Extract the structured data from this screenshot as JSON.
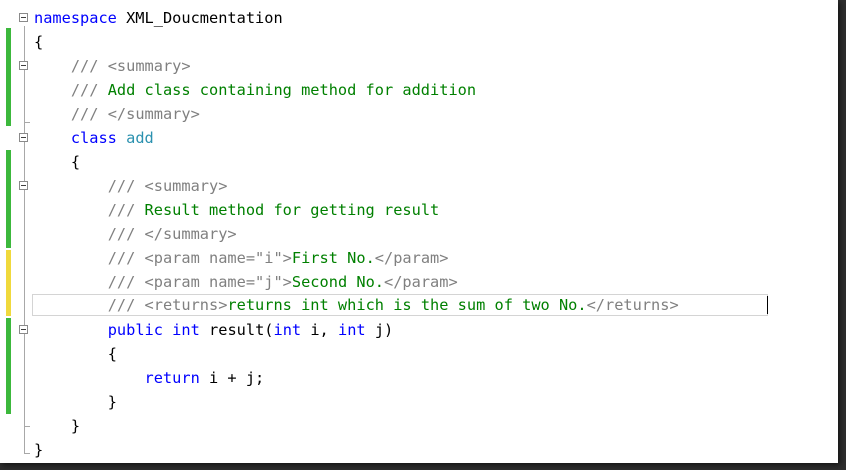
{
  "colors": {
    "keyword": "#0000ff",
    "type_name": "#2b91af",
    "comment": "#008000",
    "xml_doc_tag": "#808080",
    "saved_change_marker": "#3cb83c",
    "unsaved_change_marker": "#f0d93c"
  },
  "code": {
    "l1": {
      "kw": "namespace",
      "rest": " XML_Doucmentation"
    },
    "l2": {
      "text": "{"
    },
    "l3": {
      "indent": "    ",
      "slashes": "/// ",
      "tag": "<summary>"
    },
    "l4": {
      "indent": "    ",
      "slashes": "/// ",
      "text": "Add class containing method for addition"
    },
    "l5": {
      "indent": "    ",
      "slashes": "/// ",
      "tag": "</summary>"
    },
    "l6": {
      "indent": "    ",
      "kw": "class",
      "space": " ",
      "type": "add"
    },
    "l7": {
      "indent": "    ",
      "text": "{"
    },
    "l8": {
      "indent": "        ",
      "slashes": "/// ",
      "tag": "<summary>"
    },
    "l9": {
      "indent": "        ",
      "slashes": "/// ",
      "text": "Result method for getting result"
    },
    "l10": {
      "indent": "        ",
      "slashes": "/// ",
      "tag": "</summary>"
    },
    "l11": {
      "indent": "        ",
      "slashes": "/// ",
      "tag_open": "<param name=\"i\">",
      "text": "First No.",
      "tag_close": "</param>"
    },
    "l12": {
      "indent": "        ",
      "slashes": "/// ",
      "tag_open": "<param name=\"j\">",
      "text": "Second No.",
      "tag_close": "</param>"
    },
    "l13": {
      "indent": "        ",
      "slashes": "/// ",
      "tag_open": "<returns>",
      "text": "returns int which is the sum of two No.",
      "tag_close": "</returns>"
    },
    "l14": {
      "indent": "        ",
      "kw1": "public",
      "sp1": " ",
      "kw2": "int",
      "mid": " result(",
      "kw3": "int",
      "mid2": " i, ",
      "kw4": "int",
      "end": " j)"
    },
    "l15": {
      "indent": "        ",
      "text": "{"
    },
    "l16": {
      "indent": "            ",
      "kw": "return",
      "rest": " i + j;"
    },
    "l17": {
      "indent": "        ",
      "text": "}"
    },
    "l18": {
      "indent": "    ",
      "text": "}"
    },
    "l19": {
      "text": "}"
    }
  }
}
